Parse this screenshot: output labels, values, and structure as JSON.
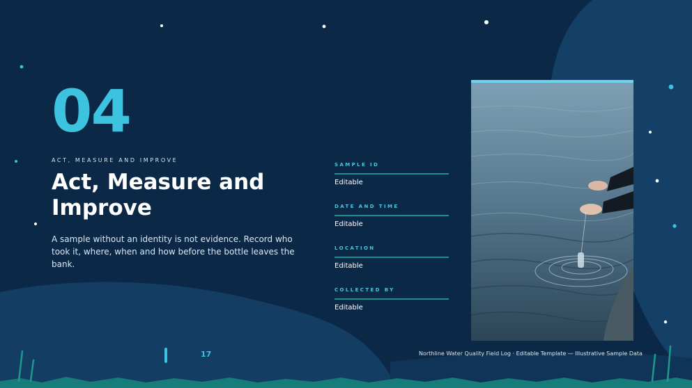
{
  "slide": {
    "number": "04",
    "eyebrow": "ACT, MEASURE AND IMPROVE",
    "title": "Act, Measure and Improve",
    "body": "A sample without an identity is not evidence. Record who took it, where, when and how before the bottle leaves the bank.",
    "fields": [
      {
        "label": "SAMPLE ID",
        "value": "Editable"
      },
      {
        "label": "DATE AND TIME",
        "value": "Editable"
      },
      {
        "label": "LOCATION",
        "value": "Editable"
      },
      {
        "label": "COLLECTED BY",
        "value": "Editable"
      }
    ],
    "page_number": "17",
    "footer": "Northline Water Quality Field Log · Editable Template — Illustrative Sample Data"
  },
  "colors": {
    "background": "#0b2847",
    "accent": "#3cc3e0",
    "rule": "#1f8f93",
    "ground": "#167d7a"
  },
  "photo": {
    "subject": "hands-lowering-sample-bottle-into-water"
  }
}
